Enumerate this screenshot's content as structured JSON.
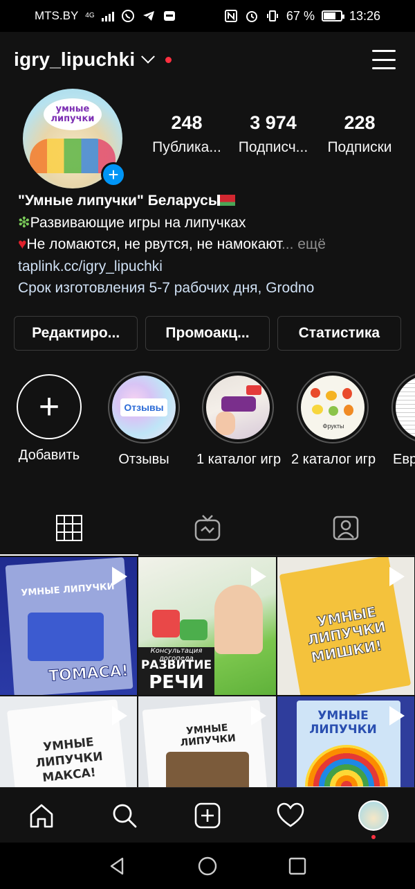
{
  "status_bar": {
    "carrier": "MTS.BY",
    "network": "4G",
    "battery": "67 %",
    "time": "13:26"
  },
  "header": {
    "username": "igry_lipuchki",
    "icons": [
      "chevron-down-icon",
      "menu-icon"
    ]
  },
  "profile": {
    "avatar_text_1": "умные",
    "avatar_text_2": "липучки",
    "stats": [
      {
        "value": "248",
        "label": "Публика..."
      },
      {
        "value": "3 974",
        "label": "Подписч..."
      },
      {
        "value": "228",
        "label": "Подписки"
      }
    ]
  },
  "bio": {
    "name": "\"Умные липучки\"  Беларусь",
    "line1": "Развивающие игры на липучках",
    "line2": "Не ломаются, не рвутся, не намокают",
    "more": "... ещё",
    "link": "taplink.cc/igry_lipuchki",
    "line3": "Срок изготовления 5-7 рабочих дня, Grodno"
  },
  "buttons": {
    "edit": "Редактиро...",
    "promo": "Промоакц...",
    "stats": "Статистика"
  },
  "highlights": [
    {
      "label": "Добавить"
    },
    {
      "label": "Отзывы",
      "cover_text": "Отзывы"
    },
    {
      "label": "1 каталог игр"
    },
    {
      "label": "2 каталог игр",
      "cover_text": "Фрукты"
    },
    {
      "label": "Евр"
    }
  ],
  "tabs": [
    "grid-icon",
    "igtv-icon",
    "tagged-icon"
  ],
  "posts": [
    {
      "text_top": "УМНЫЕ ЛИПУЧКИ",
      "text_bottom": "ТОМАСА!"
    },
    {
      "text_top": "Консультация логопеда",
      "text_mid": "РАЗВИТИЕ",
      "text_bottom": "РЕЧИ"
    },
    {
      "text_top": "УМНЫЕ",
      "text_mid": "ЛИПУЧКИ",
      "text_bottom": "МИШКИ!"
    },
    {
      "text_top": "УМНЫЕ",
      "text_mid": "ЛИПУЧКИ",
      "text_bottom": "МАКСА!"
    },
    {
      "text_top": "УМНЫЕ ЛИПУЧКИ"
    },
    {
      "text_top": "УМНЫЕ",
      "text_mid": "ЛИПУЧКИ"
    }
  ],
  "bottom_nav": [
    "home-icon",
    "search-icon",
    "new-post-icon",
    "activity-icon",
    "profile-avatar"
  ]
}
